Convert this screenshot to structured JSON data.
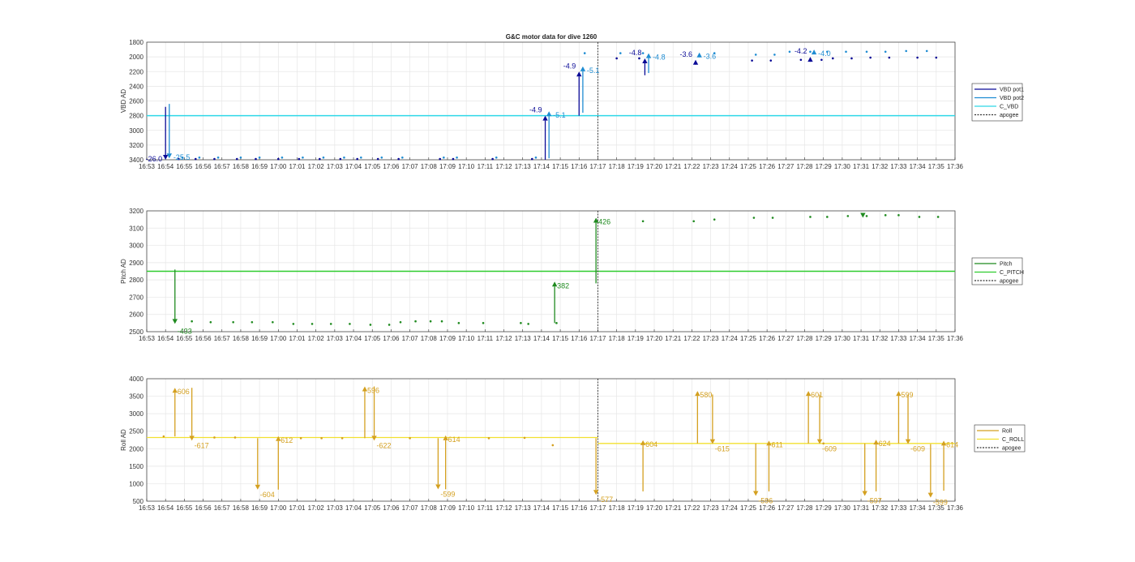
{
  "figure": {
    "title": "G&C motor data for dive 1260",
    "time_ticks": [
      "16:53",
      "16:54",
      "16:55",
      "16:56",
      "16:57",
      "16:58",
      "16:59",
      "17:00",
      "17:01",
      "17:02",
      "17:03",
      "17:04",
      "17:05",
      "17:06",
      "17:07",
      "17:08",
      "17:09",
      "17:10",
      "17:11",
      "17:12",
      "17:13",
      "17:14",
      "17:15",
      "17:16",
      "17:17",
      "17:18",
      "17:19",
      "17:20",
      "17:21",
      "17:22",
      "17:23",
      "17:24",
      "17:25",
      "17:26",
      "17:27",
      "17:28",
      "17:29",
      "17:30",
      "17:31",
      "17:32",
      "17:33",
      "17:34",
      "17:35",
      "17:36"
    ],
    "x_range_minutes": [
      0,
      43
    ]
  },
  "colors": {
    "vbd_pot1": "#0a0a96",
    "vbd_pot2": "#1e8cd2",
    "c_vbd": "#2ed8e8",
    "pitch": "#1f8a1f",
    "c_pitch": "#2ecc2e",
    "roll": "#d4a020",
    "c_roll": "#f2e030",
    "apogee": "#333333"
  },
  "chart_data": [
    {
      "type": "line",
      "ylabel": "VBD AD",
      "ylim": [
        1800,
        3400
      ],
      "y_reversed": true,
      "yticks": [
        "1800",
        "2000",
        "2200",
        "2400",
        "2600",
        "2800",
        "3000",
        "3200",
        "3400"
      ],
      "legend": {
        "position": "right",
        "entries": [
          "VBD pot1",
          "VBD pot2",
          "C_VBD",
          "apogee"
        ]
      },
      "reference_line": {
        "name": "C_VBD",
        "value": 2800
      },
      "apogee_minute": 24,
      "series": [
        {
          "name": "VBD pot1",
          "dots": [
            [
              1.7,
              3390
            ],
            [
              2.6,
              3390
            ],
            [
              3.6,
              3390
            ],
            [
              4.8,
              3390
            ],
            [
              5.8,
              3390
            ],
            [
              7.0,
              3390
            ],
            [
              8.1,
              3390
            ],
            [
              9.2,
              3390
            ],
            [
              10.3,
              3390
            ],
            [
              11.2,
              3390
            ],
            [
              12.3,
              3390
            ],
            [
              13.4,
              3390
            ],
            [
              15.6,
              3390
            ],
            [
              16.3,
              3390
            ],
            [
              18.4,
              3390
            ],
            [
              20.5,
              3390
            ],
            [
              25.0,
              2020
            ],
            [
              26.2,
              2020
            ],
            [
              32.2,
              2050
            ],
            [
              33.2,
              2050
            ],
            [
              34.8,
              2040
            ],
            [
              35.9,
              2040
            ],
            [
              36.5,
              2020
            ],
            [
              37.5,
              2020
            ],
            [
              38.5,
              2010
            ],
            [
              39.5,
              2010
            ],
            [
              41.0,
              2010
            ],
            [
              42.0,
              2010
            ]
          ]
        },
        {
          "name": "VBD pot2",
          "dots": [
            [
              1.9,
              3370
            ],
            [
              2.8,
              3370
            ],
            [
              3.8,
              3370
            ],
            [
              5.0,
              3370
            ],
            [
              6.0,
              3370
            ],
            [
              7.2,
              3370
            ],
            [
              8.3,
              3370
            ],
            [
              9.4,
              3370
            ],
            [
              10.5,
              3370
            ],
            [
              11.4,
              3370
            ],
            [
              12.5,
              3370
            ],
            [
              13.6,
              3370
            ],
            [
              15.8,
              3370
            ],
            [
              16.5,
              3370
            ],
            [
              18.6,
              3370
            ],
            [
              20.7,
              3370
            ],
            [
              23.3,
              1950
            ],
            [
              25.2,
              1950
            ],
            [
              26.4,
              1950
            ],
            [
              30.2,
              1950
            ],
            [
              32.4,
              1970
            ],
            [
              33.4,
              1970
            ],
            [
              34.2,
              1930
            ],
            [
              35.3,
              1930
            ],
            [
              36.2,
              1930
            ],
            [
              37.2,
              1930
            ],
            [
              38.3,
              1930
            ],
            [
              39.3,
              1930
            ],
            [
              40.4,
              1920
            ],
            [
              41.5,
              1920
            ]
          ]
        }
      ],
      "arrows": [
        {
          "series": "VBD pot1",
          "minute": 1.0,
          "from": 2680,
          "to": 3400,
          "label": "-26.0"
        },
        {
          "series": "VBD pot2",
          "minute": 1.2,
          "from": 2640,
          "to": 3380,
          "label": "-25.5"
        },
        {
          "series": "VBD pot1",
          "minute": 21.2,
          "from": 3400,
          "to": 2800,
          "label": "-4.9"
        },
        {
          "series": "VBD pot2",
          "minute": 21.4,
          "from": 3380,
          "to": 2740,
          "label": "-5.1"
        },
        {
          "series": "VBD pot1",
          "minute": 23.0,
          "from": 2800,
          "to": 2200,
          "label": "-4.9"
        },
        {
          "series": "VBD pot2",
          "minute": 23.2,
          "from": 2760,
          "to": 2130,
          "label": "-5.1"
        },
        {
          "series": "VBD pot1",
          "minute": 26.5,
          "from": 2250,
          "to": 2020,
          "label": "-4.8"
        },
        {
          "series": "VBD pot2",
          "minute": 26.7,
          "from": 2220,
          "to": 1950,
          "label": "-4.8"
        },
        {
          "series": "VBD pot1",
          "minute": 29.2,
          "from": 2080,
          "to": 2040,
          "label": "-3.6"
        },
        {
          "series": "VBD pot2",
          "minute": 29.4,
          "from": 1980,
          "to": 1940,
          "label": "-3.6"
        },
        {
          "series": "VBD pot1",
          "minute": 35.3,
          "from": 2050,
          "to": 2000,
          "label": "-4.2"
        },
        {
          "series": "VBD pot2",
          "minute": 35.5,
          "from": 1950,
          "to": 1900,
          "label": "-4.0"
        }
      ]
    },
    {
      "type": "line",
      "ylabel": "Pitch AD",
      "ylim": [
        2500,
        3200
      ],
      "yticks": [
        "2500",
        "2600",
        "2700",
        "2800",
        "2900",
        "3000",
        "3100",
        "3200"
      ],
      "legend": {
        "position": "right",
        "entries": [
          "Pitch",
          "C_PITCH",
          "apogee"
        ]
      },
      "reference_line": {
        "name": "C_PITCH",
        "value": 2850
      },
      "apogee_minute": 24,
      "series": [
        {
          "name": "Pitch",
          "dots": [
            [
              2.4,
              2560
            ],
            [
              3.4,
              2555
            ],
            [
              4.6,
              2555
            ],
            [
              5.6,
              2555
            ],
            [
              6.7,
              2555
            ],
            [
              7.8,
              2545
            ],
            [
              8.8,
              2545
            ],
            [
              9.8,
              2545
            ],
            [
              10.8,
              2545
            ],
            [
              11.9,
              2540
            ],
            [
              12.9,
              2540
            ],
            [
              13.5,
              2555
            ],
            [
              14.3,
              2560
            ],
            [
              15.1,
              2560
            ],
            [
              15.7,
              2560
            ],
            [
              16.6,
              2550
            ],
            [
              17.9,
              2550
            ],
            [
              19.9,
              2550
            ],
            [
              20.3,
              2545
            ],
            [
              21.8,
              2550
            ],
            [
              26.4,
              3140
            ],
            [
              29.1,
              3140
            ],
            [
              30.2,
              3150
            ],
            [
              32.3,
              3160
            ],
            [
              33.3,
              3160
            ],
            [
              35.3,
              3165
            ],
            [
              36.2,
              3165
            ],
            [
              37.3,
              3170
            ],
            [
              38.3,
              3170
            ],
            [
              39.3,
              3175
            ],
            [
              40.0,
              3175
            ],
            [
              41.1,
              3165
            ],
            [
              42.1,
              3165
            ]
          ]
        }
      ],
      "arrows": [
        {
          "series": "Pitch",
          "minute": 1.5,
          "from": 2860,
          "to": 2545,
          "label": "-433"
        },
        {
          "series": "Pitch",
          "minute": 21.7,
          "from": 2550,
          "to": 2790,
          "label": "382"
        },
        {
          "series": "Pitch",
          "minute": 23.9,
          "from": 2780,
          "to": 3160,
          "label": "426"
        },
        {
          "series": "Pitch",
          "minute": 38.1,
          "from": 3185,
          "to": 3160,
          "label": ""
        }
      ]
    },
    {
      "type": "line",
      "ylabel": "Roll AD",
      "ylim": [
        500,
        4000
      ],
      "yticks": [
        "500",
        "1000",
        "1500",
        "2000",
        "2500",
        "3000",
        "3500",
        "4000"
      ],
      "legend": {
        "position": "right",
        "entries": [
          "Roll",
          "C_ROLL",
          "apogee"
        ]
      },
      "reference_line": {
        "name": "C_ROLL",
        "segments": [
          [
            0,
            24,
            2320
          ],
          [
            24,
            43,
            2150
          ]
        ]
      },
      "apogee_minute": 24,
      "series": [
        {
          "name": "Roll",
          "dots": [
            [
              0.9,
              2350
            ],
            [
              3.6,
              2320
            ],
            [
              4.7,
              2320
            ],
            [
              8.2,
              2300
            ],
            [
              9.3,
              2300
            ],
            [
              10.4,
              2300
            ],
            [
              14.0,
              2300
            ],
            [
              18.2,
              2300
            ],
            [
              20.1,
              2310
            ],
            [
              21.6,
              2100
            ],
            [
              36.0,
              2150
            ]
          ]
        }
      ],
      "arrows": [
        {
          "series": "Roll",
          "minute": 1.5,
          "from": 2350,
          "to": 3740,
          "label": "606"
        },
        {
          "series": "Roll",
          "minute": 2.4,
          "from": 3740,
          "to": 2230,
          "label": "-617"
        },
        {
          "series": "Roll",
          "minute": 5.9,
          "from": 2300,
          "to": 830,
          "label": "-604"
        },
        {
          "series": "Roll",
          "minute": 7.0,
          "from": 830,
          "to": 2360,
          "label": "612"
        },
        {
          "series": "Roll",
          "minute": 11.6,
          "from": 2300,
          "to": 3780,
          "label": "596"
        },
        {
          "series": "Roll",
          "minute": 12.1,
          "from": 3780,
          "to": 2230,
          "label": "-622"
        },
        {
          "series": "Roll",
          "minute": 15.5,
          "from": 2300,
          "to": 840,
          "label": "-599"
        },
        {
          "series": "Roll",
          "minute": 15.9,
          "from": 840,
          "to": 2380,
          "label": "614"
        },
        {
          "series": "Roll",
          "minute": 23.9,
          "from": 2300,
          "to": 680,
          "label": "-577"
        },
        {
          "series": "Roll",
          "minute": 26.4,
          "from": 780,
          "to": 2240,
          "label": "604"
        },
        {
          "series": "Roll",
          "minute": 29.3,
          "from": 2150,
          "to": 3650,
          "label": "580"
        },
        {
          "series": "Roll",
          "minute": 30.1,
          "from": 3550,
          "to": 2130,
          "label": "-615"
        },
        {
          "series": "Roll",
          "minute": 32.4,
          "from": 2150,
          "to": 650,
          "label": "-596"
        },
        {
          "series": "Roll",
          "minute": 33.1,
          "from": 780,
          "to": 2230,
          "label": "611"
        },
        {
          "series": "Roll",
          "minute": 35.2,
          "from": 2150,
          "to": 3650,
          "label": "601"
        },
        {
          "series": "Roll",
          "minute": 35.8,
          "from": 3550,
          "to": 2130,
          "label": "-609"
        },
        {
          "series": "Roll",
          "minute": 38.2,
          "from": 2150,
          "to": 650,
          "label": "-597"
        },
        {
          "series": "Roll",
          "minute": 38.8,
          "from": 780,
          "to": 2260,
          "label": "624"
        },
        {
          "series": "Roll",
          "minute": 40.0,
          "from": 2150,
          "to": 3650,
          "label": "599"
        },
        {
          "series": "Roll",
          "minute": 40.5,
          "from": 3550,
          "to": 2130,
          "label": "-609"
        },
        {
          "series": "Roll",
          "minute": 41.7,
          "from": 2130,
          "to": 600,
          "label": "-599"
        },
        {
          "series": "Roll",
          "minute": 42.4,
          "from": 800,
          "to": 2230,
          "label": "614"
        }
      ]
    }
  ]
}
